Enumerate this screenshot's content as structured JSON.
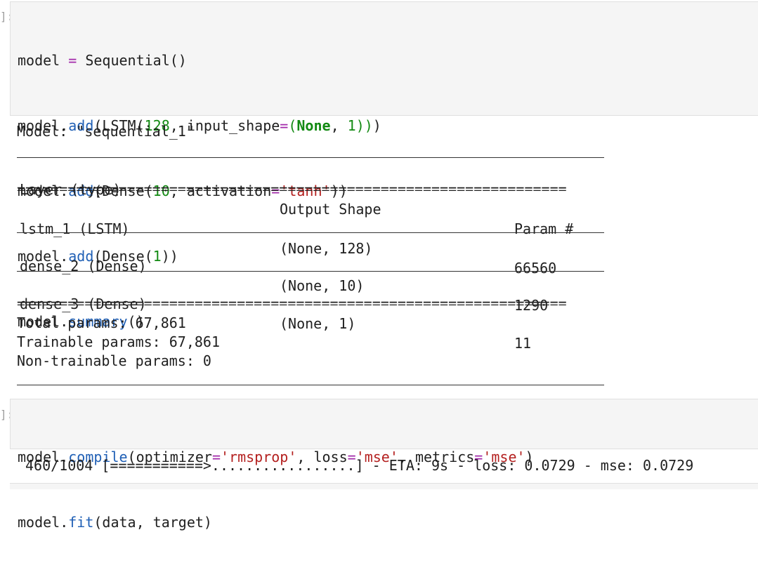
{
  "cell1": {
    "prompt": "]:",
    "code": {
      "l1": {
        "a": "model ",
        "b": "=",
        "c": " Sequential()"
      },
      "l2": {
        "a": "model.",
        "b": "add",
        "c": "(LSTM(",
        "d": "128",
        "e": ", input_shape",
        "f": "=",
        "g": "(",
        "h": "None",
        "i": ", ",
        "j": "1",
        "k": "))",
        "l": ")"
      },
      "l3": {
        "a": "model.",
        "b": "add",
        "c": "(Dense(",
        "d": "10",
        "e": ", activation",
        "f": "=",
        "g": "'tanh'",
        "h": "))"
      },
      "l4": {
        "a": "model.",
        "b": "add",
        "c": "(Dense(",
        "d": "1",
        "e": "))"
      },
      "l5": {
        "a": "model.",
        "b": "summary",
        "c": "()"
      }
    }
  },
  "summary": {
    "model_line": "Model: \"sequential_1\"",
    "headers": [
      "Layer (type)",
      "Output Shape",
      "Param #"
    ],
    "rows": [
      [
        "lstm_1 (LSTM)",
        "(None, 128)",
        "66560"
      ],
      [
        "dense_2 (Dense)",
        "(None, 10)",
        "1290"
      ],
      [
        "dense_3 (Dense)",
        "(None, 1)",
        "11"
      ]
    ],
    "total": "Total params: 67,861",
    "trainable": "Trainable params: 67,861",
    "non_trainable": "Non-trainable params: 0",
    "eq_line": "================================================================="
  },
  "cell2": {
    "prompt": "]:",
    "code": {
      "l1": {
        "a": "model.",
        "b": "compile",
        "c": "(optimizer",
        "d": "=",
        "e": "'rmsprop'",
        "f": ", loss",
        "g": "=",
        "h": "'mse'",
        "i": ", metrics",
        "j": "=",
        "k": "'mse'",
        "l": ")"
      },
      "l2": {
        "a": "model.",
        "b": "fit",
        "c": "(data, target)"
      }
    }
  },
  "progress": {
    "text": "460/1004 [===========>.................] - ETA: 9s - loss: 0.0729 - mse: 0.0729",
    "fraction": 0.458
  }
}
